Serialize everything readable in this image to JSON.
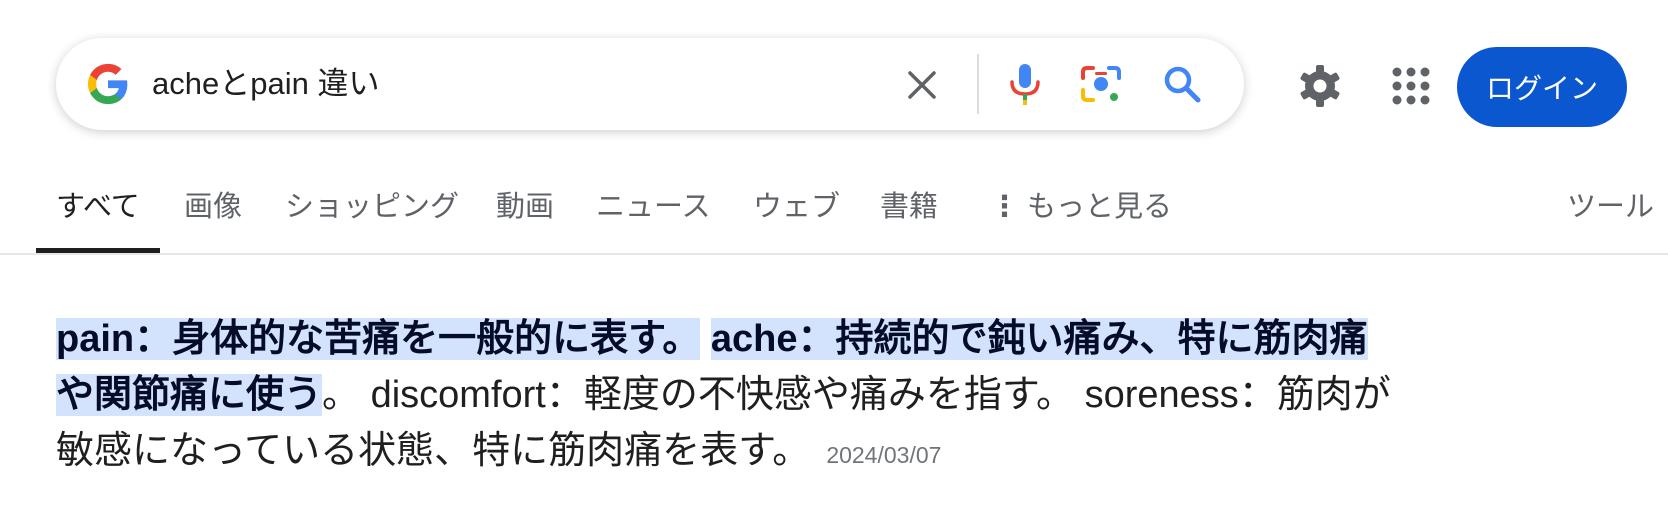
{
  "search": {
    "query": "acheとpain 違い"
  },
  "header": {
    "login_label": "ログイン"
  },
  "tabs": [
    {
      "label": "すべて",
      "active": true
    },
    {
      "label": "画像"
    },
    {
      "label": "ショッピング"
    },
    {
      "label": "動画"
    },
    {
      "label": "ニュース"
    },
    {
      "label": "ウェブ"
    },
    {
      "label": "書籍"
    },
    {
      "label": "もっと見る"
    },
    {
      "label": "ツール"
    }
  ],
  "snippet": {
    "highlight_1": "pain：身体的な苦痛を一般的に表す。",
    "highlight_2": "ache：持続的で鈍い痛み、特に筋肉痛や関節痛に使う",
    "rest": "。 discomfort：軽度の不快感や痛みを指す。 soreness：筋肉が敏感になっている状態、特に筋肉痛を表す。",
    "date": "2024/03/07"
  },
  "colors": {
    "login_bg": "#0b57d0",
    "highlight_bg": "#d3e3fd",
    "icon_blue": "#4285f4"
  },
  "icons": [
    "google-g-icon",
    "close-icon",
    "microphone-icon",
    "camera-lens-icon",
    "search-icon",
    "gear-icon",
    "apps-grid-icon",
    "more-vert-icon"
  ]
}
